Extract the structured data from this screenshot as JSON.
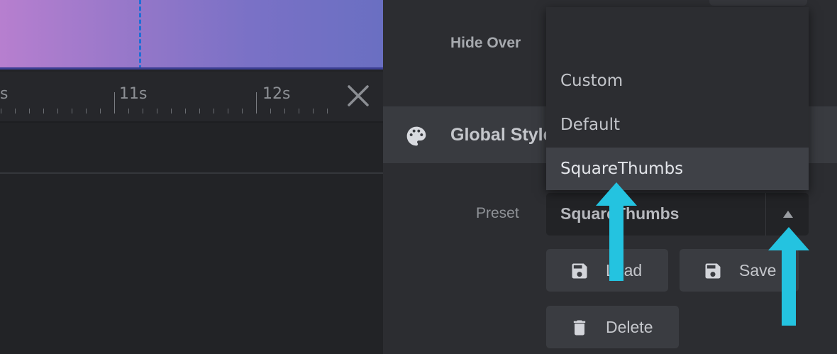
{
  "timeline": {
    "tick_prev": "s",
    "tick_11": "11s",
    "tick_12": "12s"
  },
  "settings": {
    "hide_over_label": "Hide Over",
    "global_styles_title": "Global Styles",
    "preset_label": "Preset",
    "preset_value": "SquareThumbs",
    "load_label": "Load",
    "save_label": "Save",
    "delete_label": "Delete"
  },
  "dropdown": {
    "options": [
      "Custom",
      "Default",
      "SquareThumbs"
    ],
    "selected": "SquareThumbs"
  },
  "colors": {
    "panel_bg": "#2c2d31",
    "highlight_arrow": "#24c3e0",
    "playhead": "#1f6fd6"
  },
  "icons": {
    "close": "close-icon",
    "palette": "palette-icon",
    "dropdown_arrow": "caret-up-icon",
    "load": "floppy-disk-icon",
    "save": "floppy-disk-icon",
    "delete": "trash-icon"
  }
}
